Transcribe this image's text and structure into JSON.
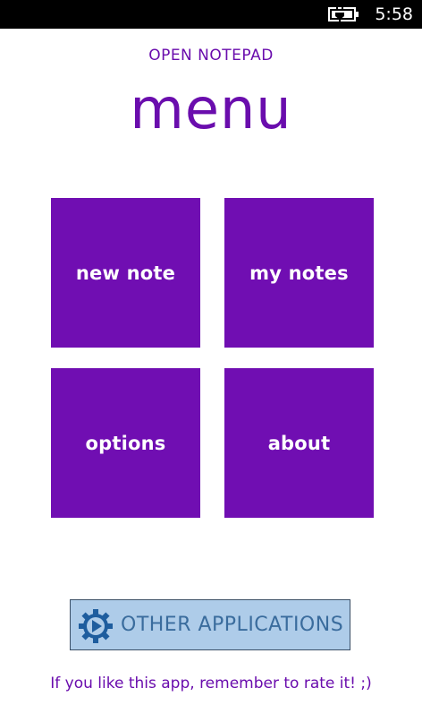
{
  "status_bar": {
    "time": "5:58",
    "battery_icon": "battery-charging-icon"
  },
  "header": {
    "app_title": "OPEN NOTEPAD",
    "page_title": "menu"
  },
  "menu_tiles": [
    {
      "label": "new note"
    },
    {
      "label": "my notes"
    },
    {
      "label": "options"
    },
    {
      "label": "about"
    }
  ],
  "other_apps": {
    "label": "OTHER APPLICATIONS",
    "icon": "gear-play-icon"
  },
  "footer": {
    "rate_text": "If you like this app, remember to rate it! ;)"
  },
  "colors": {
    "accent": "#700eb2",
    "button_bg": "#aecce9",
    "button_text": "#3a6c9d"
  }
}
